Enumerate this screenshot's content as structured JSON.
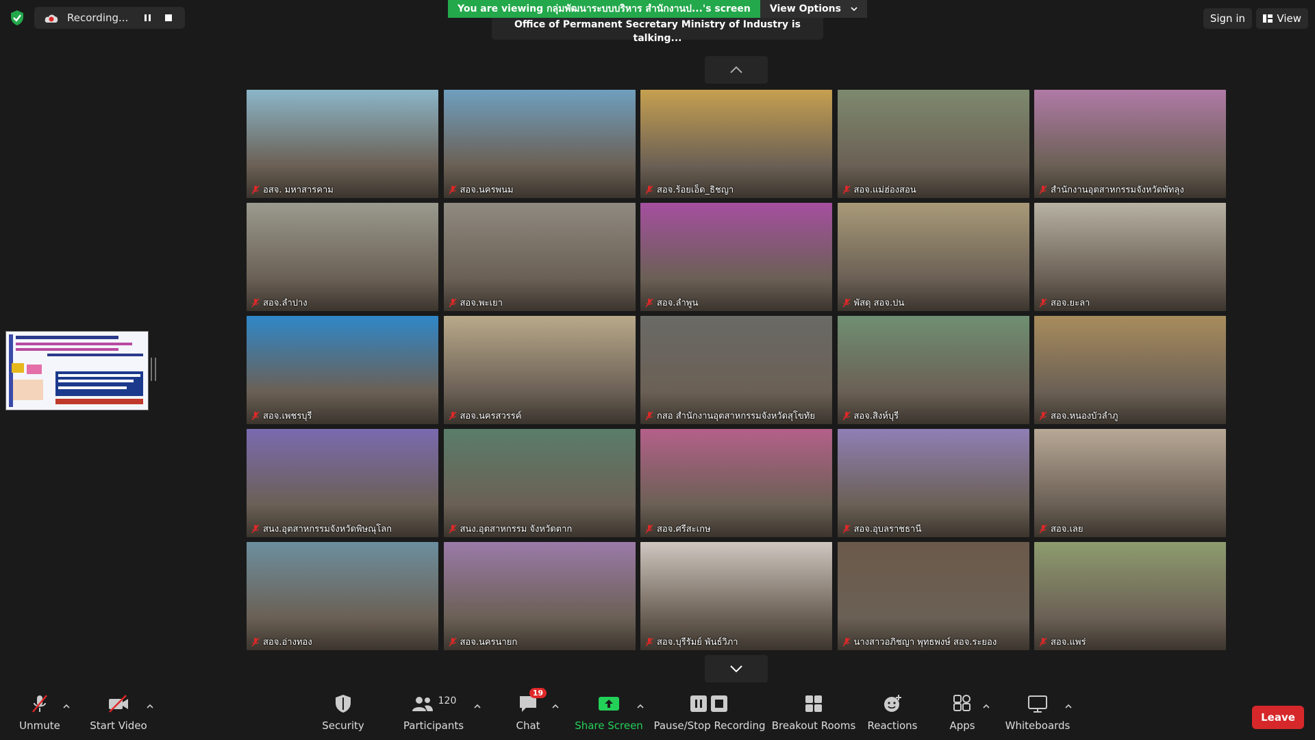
{
  "top": {
    "recording_label": "Recording...",
    "banner_text": "You are viewing กลุ่มพัฒนาระบบบริหาร สำนักงานป...'s screen",
    "view_options": "View Options",
    "talking_text": "Office of Permanent Secretary Ministry of Industry is talking...",
    "sign_in": "Sign in",
    "view": "View"
  },
  "participants_grid": [
    {
      "name": "อสจ. มหาสารคาม",
      "color": "#8bb6c9"
    },
    {
      "name": "สอจ.นครพนม",
      "color": "#6f9fbf"
    },
    {
      "name": "สอจ.ร้อยเอ็ด_ธิชญา",
      "color": "#c6a050"
    },
    {
      "name": "สอจ.แม่ฮ่องสอน",
      "color": "#7d8a6e"
    },
    {
      "name": "สำนักงานอุตสาหกรรมจังหวัดพัทลุง",
      "color": "#b07aa6"
    },
    {
      "name": "สอจ.ลำปาง",
      "color": "#9a9a8e"
    },
    {
      "name": "สอจ.พะเยา",
      "color": "#8f8a80"
    },
    {
      "name": "สอจ.ลำพูน",
      "color": "#a54fa0"
    },
    {
      "name": "พัสดุ สอจ.ปน",
      "color": "#a89a78"
    },
    {
      "name": "สอจ.ยะลา",
      "color": "#b7b2a3"
    },
    {
      "name": "สอจ.เพชรบุรี",
      "color": "#2f87c8"
    },
    {
      "name": "สอจ.นครสวรรค์",
      "color": "#b9a98a"
    },
    {
      "name": "กสอ สำนักงานอุตสาหกรรมจังหวัดสุโขทัย",
      "color": "#6a6a66"
    },
    {
      "name": "สอจ.สิงห์บุรี",
      "color": "#6f8f72"
    },
    {
      "name": "สอจ.หนองบัวลำภู",
      "color": "#a88c5c"
    },
    {
      "name": "สนง.อุตสาหกรรมจังหวัดพิษณุโลก",
      "color": "#7a6ab0"
    },
    {
      "name": "สนง.อุตสาหกรรม จังหวัดตาก",
      "color": "#5a7d6a"
    },
    {
      "name": "สอจ.ศรีสะเกษ",
      "color": "#b4608a"
    },
    {
      "name": "สอจ.อุบลราชธานี",
      "color": "#8f7fb6"
    },
    {
      "name": "สอจ.เลย",
      "color": "#b8a896"
    },
    {
      "name": "สอจ.อ่างทอง",
      "color": "#6c8f9e"
    },
    {
      "name": "สอจ.นครนายก",
      "color": "#9b7aa8"
    },
    {
      "name": "สอจ.บุรีรัมย์ พันธ์วิภา",
      "color": "#cfc7c0"
    },
    {
      "name": "นางสาวอภิชญา พุทธพงษ์ สอจ.ระยอง",
      "color": "#6b5a4a"
    },
    {
      "name": "สอจ.แพร่",
      "color": "#8d9c6e"
    }
  ],
  "toolbar": {
    "unmute": "Unmute",
    "start_video": "Start Video",
    "security": "Security",
    "participants": "Participants",
    "participants_count": "120",
    "chat": "Chat",
    "chat_badge": "19",
    "share_screen": "Share Screen",
    "pause_stop_recording": "Pause/Stop Recording",
    "breakout_rooms": "Breakout Rooms",
    "reactions": "Reactions",
    "apps": "Apps",
    "whiteboards": "Whiteboards",
    "leave": "Leave"
  },
  "colors": {
    "banner_green": "#23a84b",
    "share_green": "#23d159",
    "leave_red": "#d6282a",
    "muted_red": "#e02828"
  }
}
